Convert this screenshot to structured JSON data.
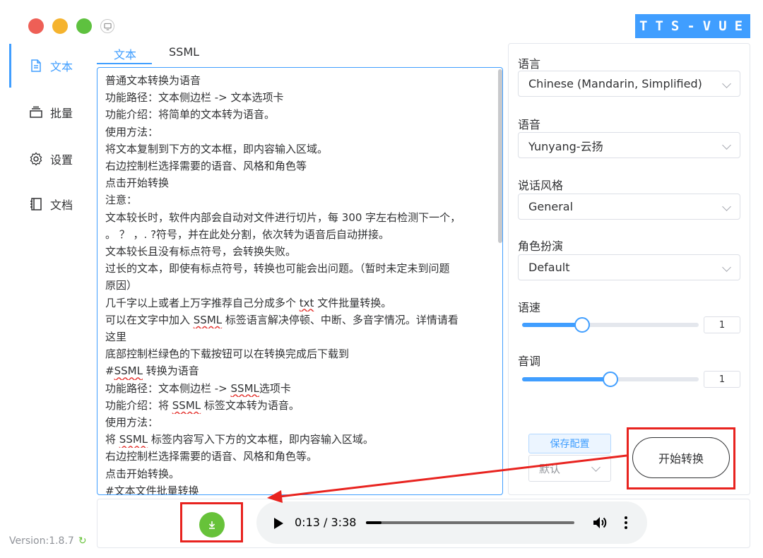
{
  "window": {
    "brand": "TTS-VUE",
    "colors": {
      "close": "#ee5f56",
      "minimize": "#f5b32e",
      "maximize": "#5ec13f",
      "accent": "#409eff",
      "download": "#67c23a",
      "annotation": "#e8231f"
    }
  },
  "sidebar": {
    "items": [
      {
        "label": "文本",
        "icon": "document-icon",
        "active": true
      },
      {
        "label": "批量",
        "icon": "batch-icon",
        "active": false
      },
      {
        "label": "设置",
        "icon": "gear-icon",
        "active": false
      },
      {
        "label": "文档",
        "icon": "book-icon",
        "active": false
      }
    ],
    "version": "Version:1.8.7"
  },
  "tabs": [
    {
      "label": "文本",
      "active": true
    },
    {
      "label": "SSML",
      "active": false
    }
  ],
  "editor": {
    "lines": [
      "普通文本转换为语音",
      "功能路径：文本侧边栏 -> 文本选项卡",
      "功能介绍：将简单的文本转为语音。",
      "使用方法：",
      "将文本复制到下方的文本框，即内容输入区域。",
      "右边控制栏选择需要的语音、风格和角色等",
      "点击开始转换",
      "注意：",
      "文本较长时，软件内部会自动对文件进行切片，每 300 字左右检测下一个，",
      "。 ？ ，. ?符号，并在此处分割，依次转为语音后自动拼接。",
      "文本较长且没有标点符号，会转换失败。",
      "过长的文本，即使有标点符号，转换也可能会出问题。（暂时未定未到问题",
      "原因）",
      "几千字以上或者上万字推荐自己分成多个 txt 文件批量转换。",
      "可以在文字中加入 SSML 标签语言解决停顿、中断、多音字情况。详情请看",
      "这里",
      "底部控制栏绿色的下载按钮可以在转换完成后下载到",
      "#SSML 转换为语音",
      "功能路径：文本侧边栏 -> SSML选项卡",
      "功能介绍：将 SSML 标签文本转为语音。",
      "使用方法：",
      "将 SSML 标签内容写入下方的文本框，即内容输入区域。",
      "右边控制栏选择需要的语音、风格和角色等。",
      "点击开始转换。",
      "#文本文件批量转换"
    ]
  },
  "settings": {
    "language_label": "语言",
    "language_value": "Chinese (Mandarin, Simplified)",
    "voice_label": "语音",
    "voice_value": "Yunyang-云扬",
    "style_label": "说话风格",
    "style_value": "General",
    "role_label": "角色扮演",
    "role_value": "Default",
    "rate_label": "语速",
    "rate_value": "1",
    "rate_fraction": 0.34,
    "pitch_label": "音调",
    "pitch_value": "1",
    "pitch_fraction": 0.5,
    "save_config_label": "保存配置",
    "config_value": "默认",
    "start_label": "开始转换"
  },
  "player": {
    "time": "0:13 / 3:38",
    "progress_fraction": 0.075
  }
}
